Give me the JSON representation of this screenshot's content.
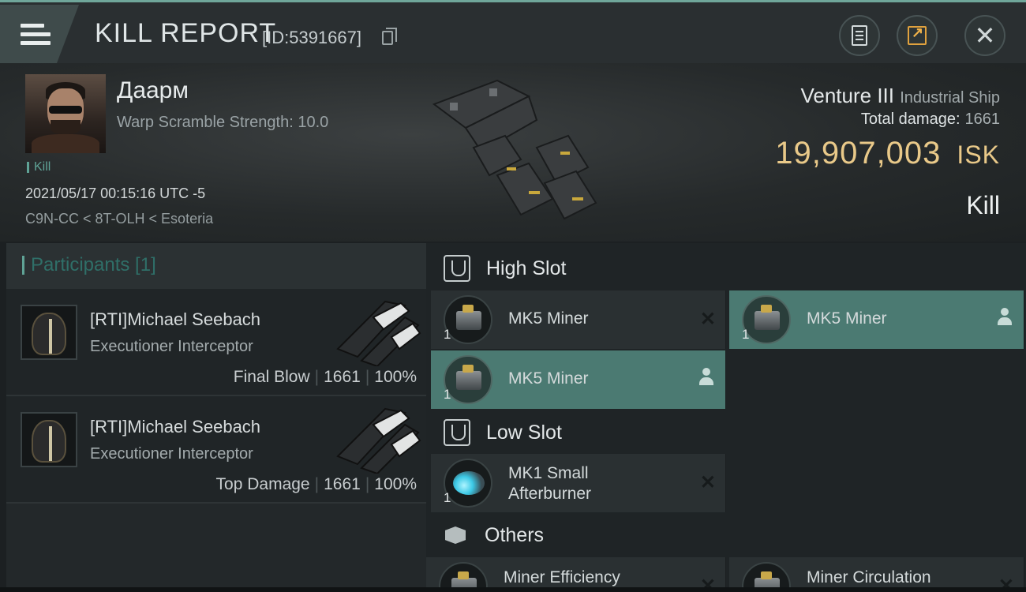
{
  "header": {
    "title": "KILL REPORT",
    "report_id": "[ID:5391667]"
  },
  "victim": {
    "name": "Даарм",
    "warp_scramble": "Warp Scramble Strength: 10.0",
    "tag": "Kill",
    "datetime": "2021/05/17 00:15:16 UTC -5",
    "location": "C9N-CC < 8T-OLH < Esoteria"
  },
  "ship": {
    "name": "Venture III",
    "type": "Industrial Ship",
    "total_damage_label": "Total damage:",
    "total_damage": "1661",
    "isk_value": "19,907,003",
    "isk_unit": "ISK",
    "result": "Kill"
  },
  "participants": {
    "header": "Participants [1]",
    "rows": [
      {
        "name": "[RTI]Michael Seebach",
        "ship": "Executioner Interceptor",
        "role": "Final Blow",
        "damage": "1661",
        "percent": "100%"
      },
      {
        "name": "[RTI]Michael Seebach",
        "ship": "Executioner Interceptor",
        "role": "Top Damage",
        "damage": "1661",
        "percent": "100%"
      }
    ]
  },
  "fittings": {
    "high_slot": {
      "title": "High Slot",
      "modules": [
        {
          "name": "MK5 Miner",
          "qty": "1"
        },
        {
          "name": "MK5 Miner",
          "qty": "1"
        },
        {
          "name": "MK5 Miner",
          "qty": "1"
        }
      ]
    },
    "low_slot": {
      "title": "Low Slot",
      "modules": [
        {
          "name_line1": "MK1 Small",
          "name_line2": "Afterburner",
          "qty": "1"
        }
      ]
    },
    "others": {
      "title": "Others",
      "modules": [
        {
          "name": "Miner Efficiency"
        },
        {
          "name": "Miner Circulation"
        }
      ]
    }
  },
  "icons": {
    "menu": "menu-icon",
    "copy": "copy-icon",
    "report": "document-icon",
    "share": "share-icon",
    "close": "close-icon",
    "remove": "x-icon",
    "pilot": "pilot-icon"
  },
  "colors": {
    "accent": "#5fa396",
    "isk": "#e9c989",
    "selected_module": "#4b7a72"
  }
}
